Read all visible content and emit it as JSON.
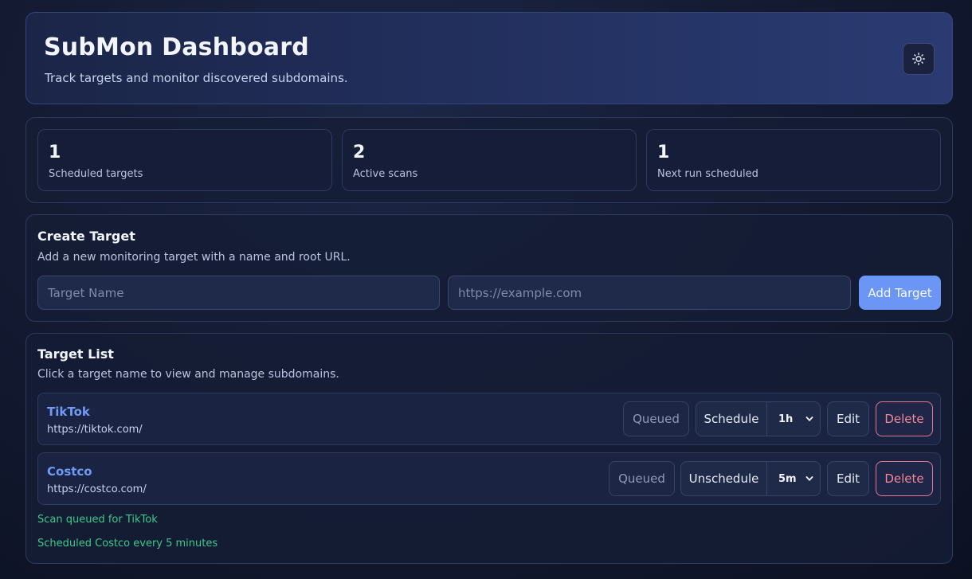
{
  "header": {
    "title": "SubMon Dashboard",
    "subtitle": "Track targets and monitor discovered subdomains.",
    "theme_icon": "sun-icon"
  },
  "stats": [
    {
      "value": "1",
      "label": "Scheduled targets"
    },
    {
      "value": "2",
      "label": "Active scans"
    },
    {
      "value": "1",
      "label": "Next run scheduled"
    }
  ],
  "create": {
    "title": "Create Target",
    "subtitle": "Add a new monitoring target with a name and root URL.",
    "name_placeholder": "Target Name",
    "url_placeholder": "https://example.com",
    "add_label": "Add Target"
  },
  "list": {
    "title": "Target List",
    "subtitle": "Click a target name to view and manage subdomains.",
    "targets": [
      {
        "name": "TikTok",
        "url": "https://tiktok.com/",
        "status": "Queued",
        "schedule_label": "Schedule",
        "interval": "1h",
        "edit_label": "Edit",
        "delete_label": "Delete"
      },
      {
        "name": "Costco",
        "url": "https://costco.com/",
        "status": "Queued",
        "schedule_label": "Unschedule",
        "interval": "5m",
        "edit_label": "Edit",
        "delete_label": "Delete"
      }
    ],
    "messages": [
      "Scan queued for TikTok",
      "Scheduled Costco every 5 minutes"
    ]
  },
  "colors": {
    "accent": "#6b96f5",
    "success_text": "#3fc98a",
    "danger": "#f08897"
  }
}
